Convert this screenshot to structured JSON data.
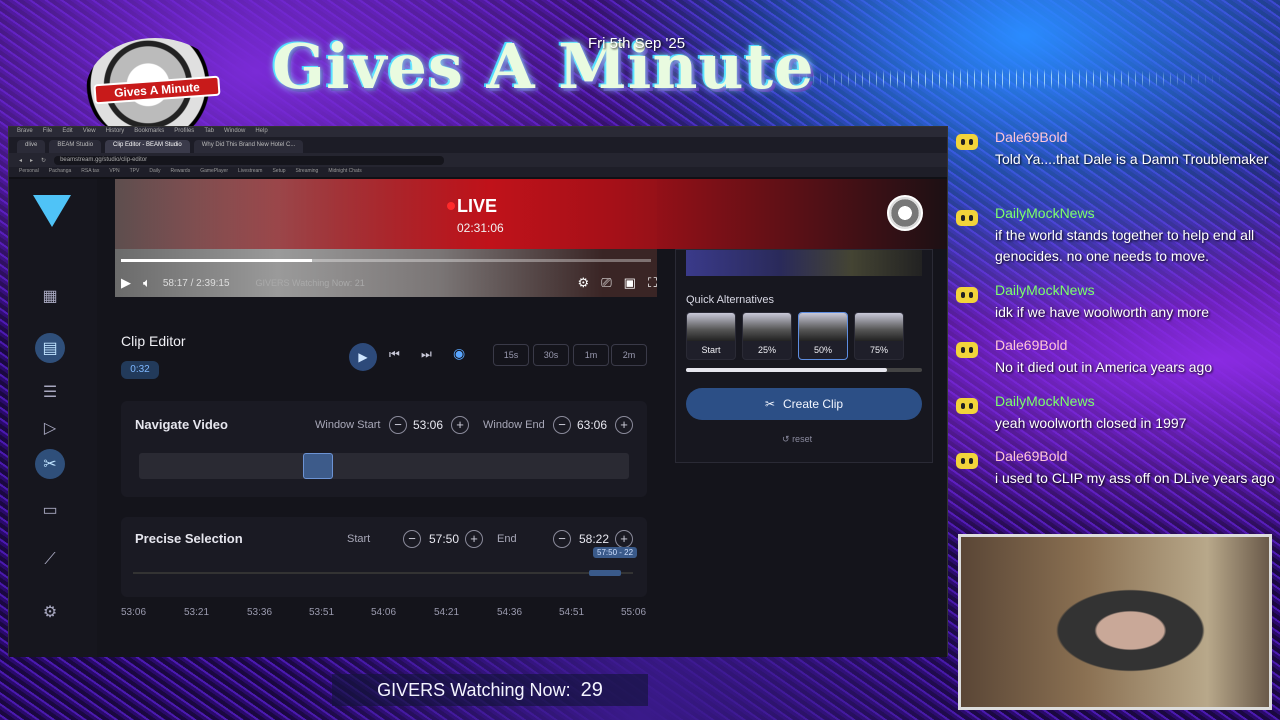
{
  "overlay": {
    "title": "Gives A Minute",
    "date": "Fri 5th Sep '25",
    "logo_text": "Gives A Minute"
  },
  "browser": {
    "menu": [
      "Brave",
      "File",
      "Edit",
      "View",
      "History",
      "Bookmarks",
      "Profiles",
      "Tab",
      "Window",
      "Help"
    ],
    "tabs": [
      "dlive",
      "BEAM Studio",
      "Clip Editor - BEAM Studio",
      "Why Did This Brand New Hotel C..."
    ],
    "url": "beamstream.gg/studio/clip-editor",
    "bookmarks": [
      "Personal",
      "Pachanga",
      "RSA tax",
      "VPN",
      "TPV",
      "Daily",
      "Rewards",
      "GamePlayer",
      "Livestream",
      "Setup",
      "Streaming",
      "Midnight Chats"
    ]
  },
  "live": {
    "label": "LIVE",
    "elapsed": "02:31:06"
  },
  "video": {
    "time": "58:17 / 2:39:15",
    "overlay": "GIVERS Watching Now: 21",
    "progress": 0.36
  },
  "clip_editor": {
    "title": "Clip Editor",
    "duration_badge": "0:32",
    "presets": [
      "15s",
      "30s",
      "1m",
      "2m"
    ],
    "navigate": {
      "title": "Navigate Video",
      "window_start_label": "Window Start",
      "window_start": "53:06",
      "window_end_label": "Window End",
      "window_end": "63:06"
    },
    "precise": {
      "title": "Precise Selection",
      "start_label": "Start",
      "start": "57:50",
      "end_label": "End",
      "end": "58:22",
      "tooltip": "57:50 - 22"
    },
    "timeline_ticks": [
      "53:06",
      "53:21",
      "53:36",
      "53:51",
      "54:06",
      "54:21",
      "54:36",
      "54:51",
      "55:06"
    ]
  },
  "side_panel": {
    "quick_alternatives_title": "Quick Alternatives",
    "alternatives": [
      "Start",
      "25%",
      "50%",
      "75%"
    ],
    "selected_alternative": "50%",
    "create_clip_label": "Create Clip",
    "reset_label": "reset"
  },
  "chat": [
    {
      "user": "Dale69Bold",
      "text": "Told Ya....that Dale is a Damn Troublemaker"
    },
    {
      "user": "DailyMockNews",
      "text": "if the world stands together to help end all genocides. no one needs to move."
    },
    {
      "user": "DailyMockNews",
      "text": "idk if we have woolworth any more"
    },
    {
      "user": "Dale69Bold",
      "text": "No it died out in America years ago"
    },
    {
      "user": "DailyMockNews",
      "text": "yeah woolworth closed in 1997"
    },
    {
      "user": "Dale69Bold",
      "text": "i used to CLIP my ass off on DLive years ago"
    }
  ],
  "watching": {
    "label": "GIVERS Watching Now:",
    "count": "29"
  },
  "colors": {
    "accent_blue": "#2c4f86",
    "live_red": "#c0121a",
    "chat_name_dale": "#ffc6d8",
    "chat_name_dmn": "#7dff6a"
  }
}
